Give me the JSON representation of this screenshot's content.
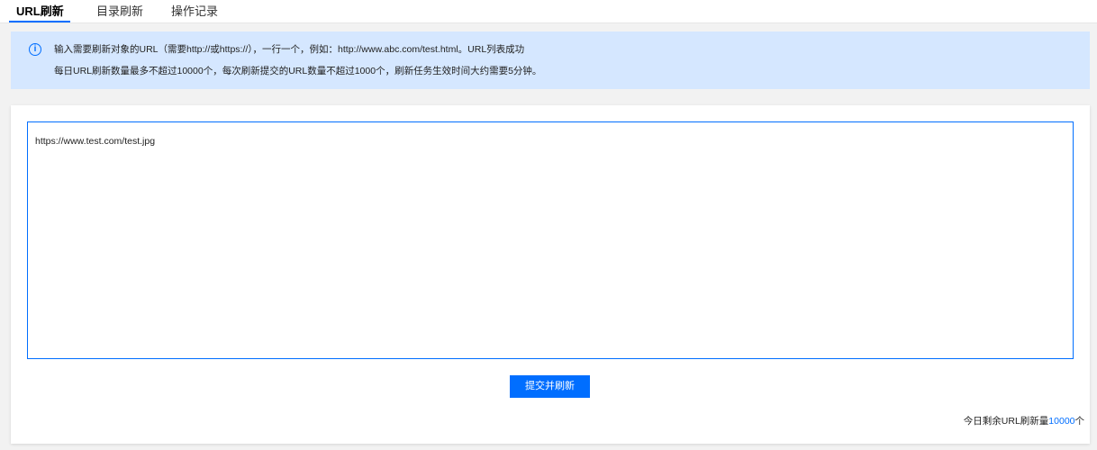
{
  "tabs": [
    {
      "label": "URL刷新",
      "active": true
    },
    {
      "label": "目录刷新",
      "active": false
    },
    {
      "label": "操作记录",
      "active": false
    }
  ],
  "notice": {
    "icon": "info-icon",
    "line1": "输入需要刷新对象的URL（需要http://或https://），一行一个，例如：http://www.abc.com/test.html。URL列表成功",
    "line2": "每日URL刷新数量最多不超过10000个，每次刷新提交的URL数量不超过1000个，刷新任务生效时间大约需要5分钟。"
  },
  "form": {
    "textarea_value": "https://www.test.com/test.jpg",
    "submit_label": "提交并刷新"
  },
  "quota": {
    "prefix": "今日剩余URL刷新量",
    "count": "10000",
    "suffix": "个"
  },
  "colors": {
    "accent": "#006eff",
    "notice_bg": "#d5e7ff",
    "page_bg": "#f2f2f2"
  }
}
